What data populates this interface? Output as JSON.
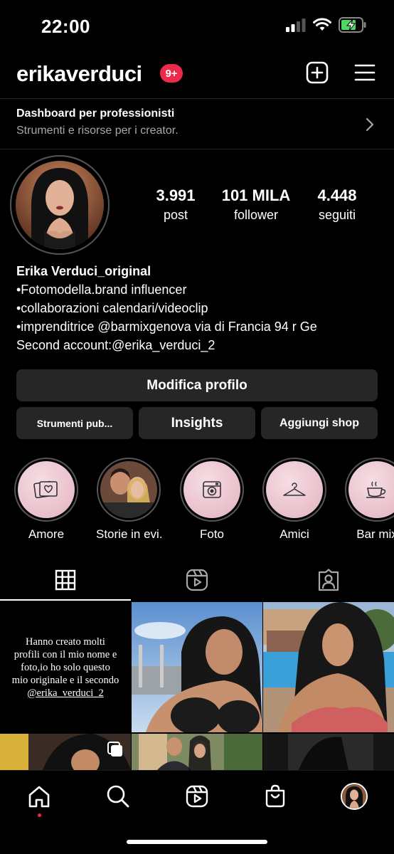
{
  "status_bar": {
    "time": "22:00"
  },
  "header": {
    "username": "erikaverduci",
    "notification_badge": "9+"
  },
  "dashboard": {
    "title": "Dashboard per professionisti",
    "subtitle": "Strumenti e risorse per i creator."
  },
  "profile": {
    "stats": [
      {
        "number": "3.991",
        "label": "post"
      },
      {
        "number": "101 MILA",
        "label": "follower"
      },
      {
        "number": "4.448",
        "label": "seguiti"
      }
    ],
    "bio": {
      "name": "Erika Verduci_original",
      "lines": [
        "•Fotomodella.brand influencer",
        "•collaborazioni calendari/videoclip",
        "•imprenditrice @barmixgenova via di Francia 94 r Ge",
        "Second account:@erika_verduci_2"
      ]
    }
  },
  "buttons": {
    "edit_profile": "Modifica profilo",
    "ad_tools": "Strumenti pub...",
    "insights": "Insights",
    "add_shop": "Aggiungi shop"
  },
  "highlights": [
    {
      "label": "Amore",
      "icon": "photos-heart-icon"
    },
    {
      "label": "Storie in evi...",
      "icon": "photo"
    },
    {
      "label": "Foto",
      "icon": "camera-icon"
    },
    {
      "label": "Amici",
      "icon": "hanger-icon"
    },
    {
      "label": "Bar mix",
      "icon": "coffee-cup-icon"
    }
  ],
  "tabs": [
    {
      "name": "grid",
      "icon": "grid-icon",
      "active": true
    },
    {
      "name": "reels",
      "icon": "reels-icon",
      "active": false
    },
    {
      "name": "tagged",
      "icon": "tagged-icon",
      "active": false
    }
  ],
  "grid": {
    "first_post_lines": [
      "Hanno creato molti",
      "profili con il mio nome e",
      "foto,io ho solo questo",
      "mio originale e il secondo",
      "@erika_verduci_2"
    ]
  },
  "bottom_nav": [
    {
      "name": "home",
      "icon": "home-icon"
    },
    {
      "name": "search",
      "icon": "search-icon"
    },
    {
      "name": "reels",
      "icon": "reels-icon"
    },
    {
      "name": "shop",
      "icon": "shopping-bag-icon"
    },
    {
      "name": "profile",
      "icon": "avatar"
    }
  ],
  "colors": {
    "background": "#000000",
    "button": "#262626",
    "badge": "#ed2a4b",
    "secondary_text": "#a8a8a8"
  }
}
